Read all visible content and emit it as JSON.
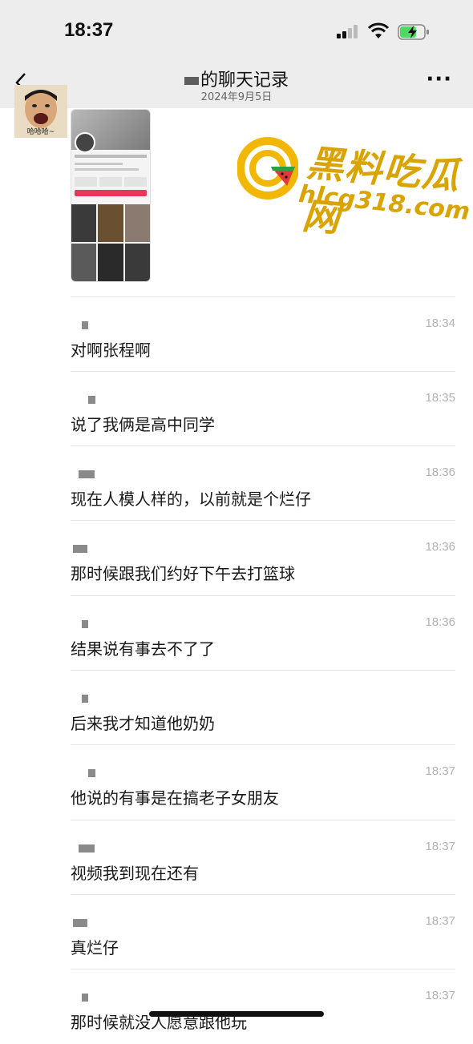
{
  "status_bar": {
    "time": "18:37"
  },
  "nav": {
    "title": "的聊天记录",
    "subtitle": "2024年9月5日",
    "back_icon": "chevron-left-icon",
    "more_icon": "ellipsis-icon"
  },
  "avatar": {
    "caption": "哈哈哈~"
  },
  "watermark": {
    "brand": "黑料吃瓜网",
    "url": "hlcg318.com"
  },
  "messages": [
    {
      "time": "18:34",
      "text": "对啊张程啊"
    },
    {
      "time": "18:35",
      "text": "说了我俩是高中同学"
    },
    {
      "time": "18:36",
      "text": "现在人模人样的，以前就是个烂仔"
    },
    {
      "time": "18:36",
      "text": "那时候跟我们约好下午去打篮球"
    },
    {
      "time": "18:36",
      "text": "结果说有事去不了了"
    },
    {
      "time": "",
      "text": "后来我才知道他奶奶"
    },
    {
      "time": "18:37",
      "text": "他说的有事是在搞老子女朋友"
    },
    {
      "time": "18:37",
      "text": "视频我到现在还有"
    },
    {
      "time": "18:37",
      "text": "真烂仔"
    },
    {
      "time": "18:37",
      "text": "那时候就没人愿意跟他玩"
    }
  ]
}
